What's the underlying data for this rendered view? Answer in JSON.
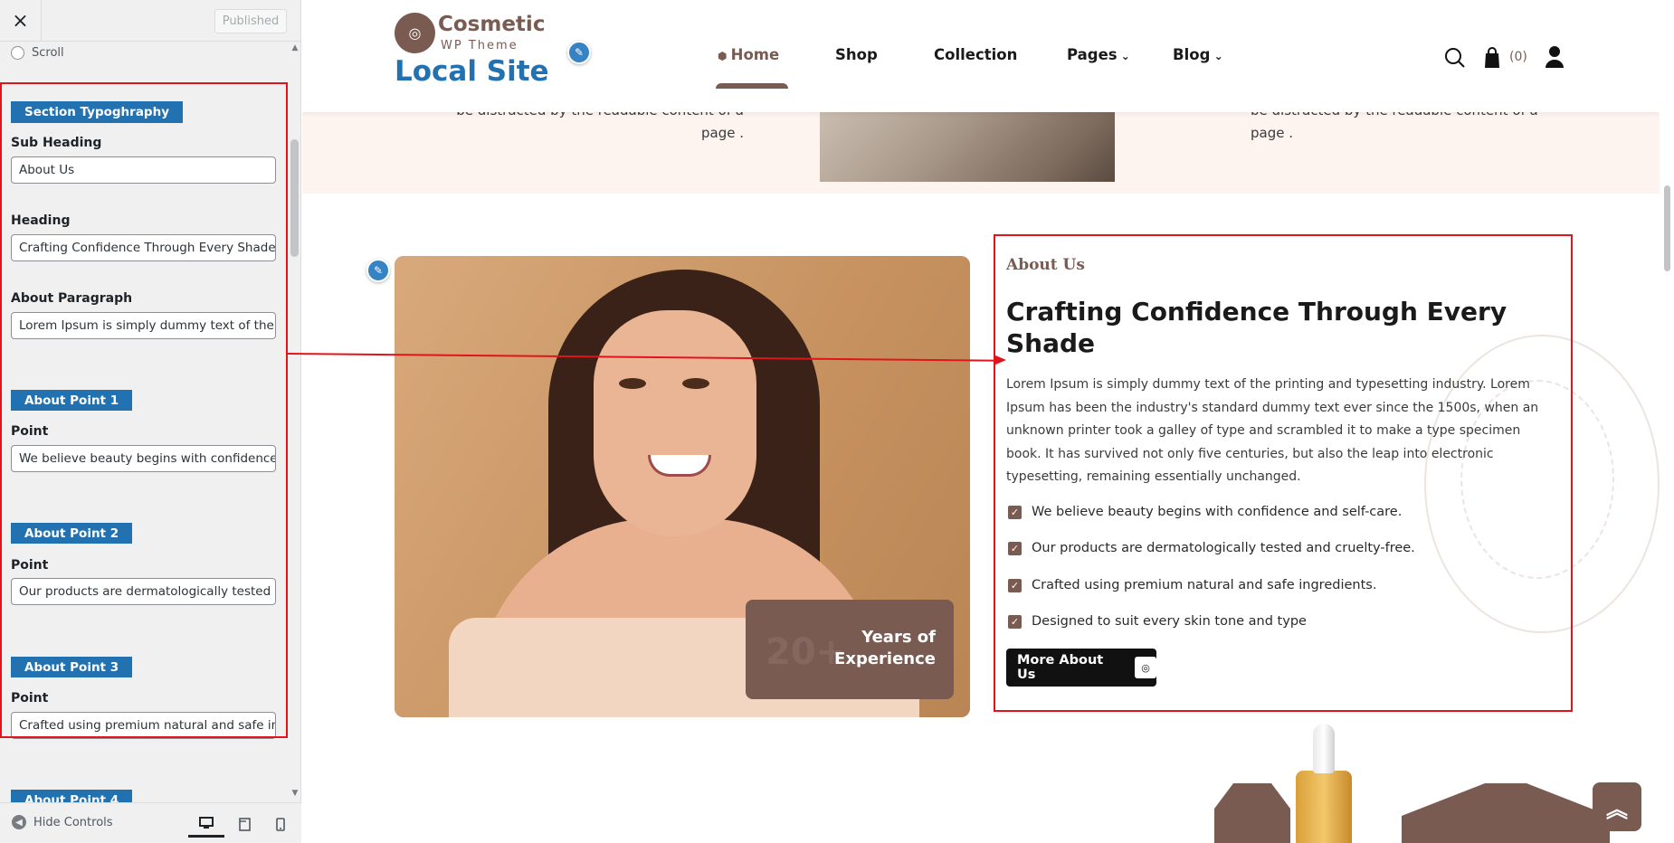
{
  "sidebar": {
    "close_label": "×",
    "published_label": "Published",
    "scroll_option": "Scroll",
    "section_typography": "Section Typoghraphy",
    "sub_heading_label": "Sub Heading",
    "sub_heading_value": "About Us",
    "heading_label": "Heading",
    "heading_value": "Crafting Confidence Through Every Shade",
    "paragraph_label": "About Paragraph",
    "paragraph_value": "Lorem Ipsum is simply dummy text of the printing and typesetting industry.",
    "point1_badge": "About Point 1",
    "point1_label": "Point",
    "point1_value": "We believe beauty begins with confidence and self-care.",
    "point2_badge": "About Point 2",
    "point2_label": "Point",
    "point2_value": "Our products are dermatologically tested and cruelty-free.",
    "point3_badge": "About Point 3",
    "point3_label": "Point",
    "point3_value": "Crafted using premium natural and safe ingredients.",
    "point4_badge": "About Point 4",
    "hide_controls": "Hide Controls",
    "devices": [
      "desktop-icon",
      "tablet-icon",
      "mobile-icon"
    ]
  },
  "header": {
    "logo_brand": "Cosmetic",
    "logo_sub": "WP Theme",
    "site_title": "Local Site",
    "nav": [
      "Home",
      "Shop",
      "Collection",
      "Pages",
      "Blog"
    ],
    "cart_count": "(0)"
  },
  "band": {
    "left_text_1": "be distracted by the readable content of a",
    "left_text_2": "page .",
    "right_text_1": "be distracted by the readable content of a",
    "right_text_2": "page ."
  },
  "experience": {
    "number": "20+",
    "text_1": "Years of",
    "text_2": "Experience"
  },
  "about": {
    "sub_heading": "About Us",
    "heading": "Crafting Confidence Through Every Shade",
    "paragraph": "Lorem Ipsum is simply dummy text of the printing and typesetting industry. Lorem Ipsum has been the industry's standard dummy text ever since the 1500s, when an unknown printer took a galley of type and scrambled it to make a type specimen book. It has survived not only five centuries, but also the leap into electronic typesetting, remaining essentially unchanged.",
    "points": [
      "We believe beauty begins with confidence and self-care.",
      "Our products are dermatologically tested and cruelty-free.",
      "Crafted using premium natural and safe ingredients.",
      "Designed to suit every skin tone and type"
    ],
    "button_label": "More About Us"
  },
  "colors": {
    "brand_brown": "#7a5b52",
    "wp_blue": "#2271b1",
    "annotation_red": "#e0151b"
  }
}
